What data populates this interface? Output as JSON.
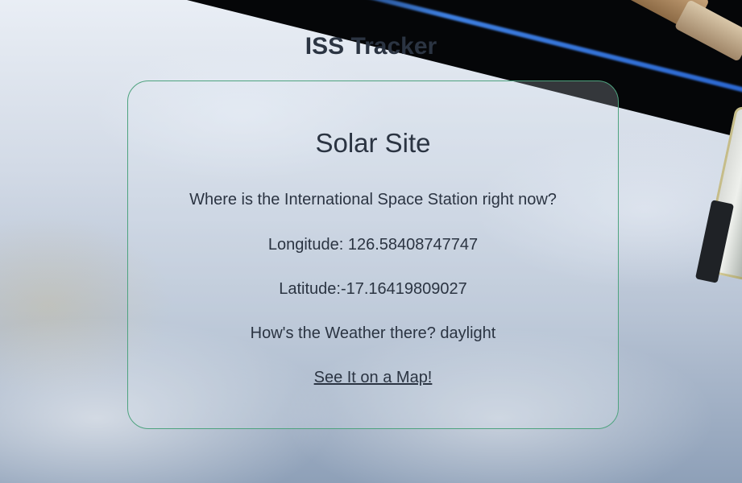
{
  "header": {
    "title": "ISS Tracker"
  },
  "card": {
    "title": "Solar Site",
    "question": "Where is the International Space Station right now?",
    "longitude_text": "Longitude: 126.58408747747",
    "latitude_text": "Latitude:-17.16419809027",
    "weather_text": "How's the Weather there? daylight",
    "map_link_label": "See It on a Map!"
  },
  "colors": {
    "text": "#2b3442",
    "card_border": "#4ea37f",
    "space": "#050608"
  }
}
